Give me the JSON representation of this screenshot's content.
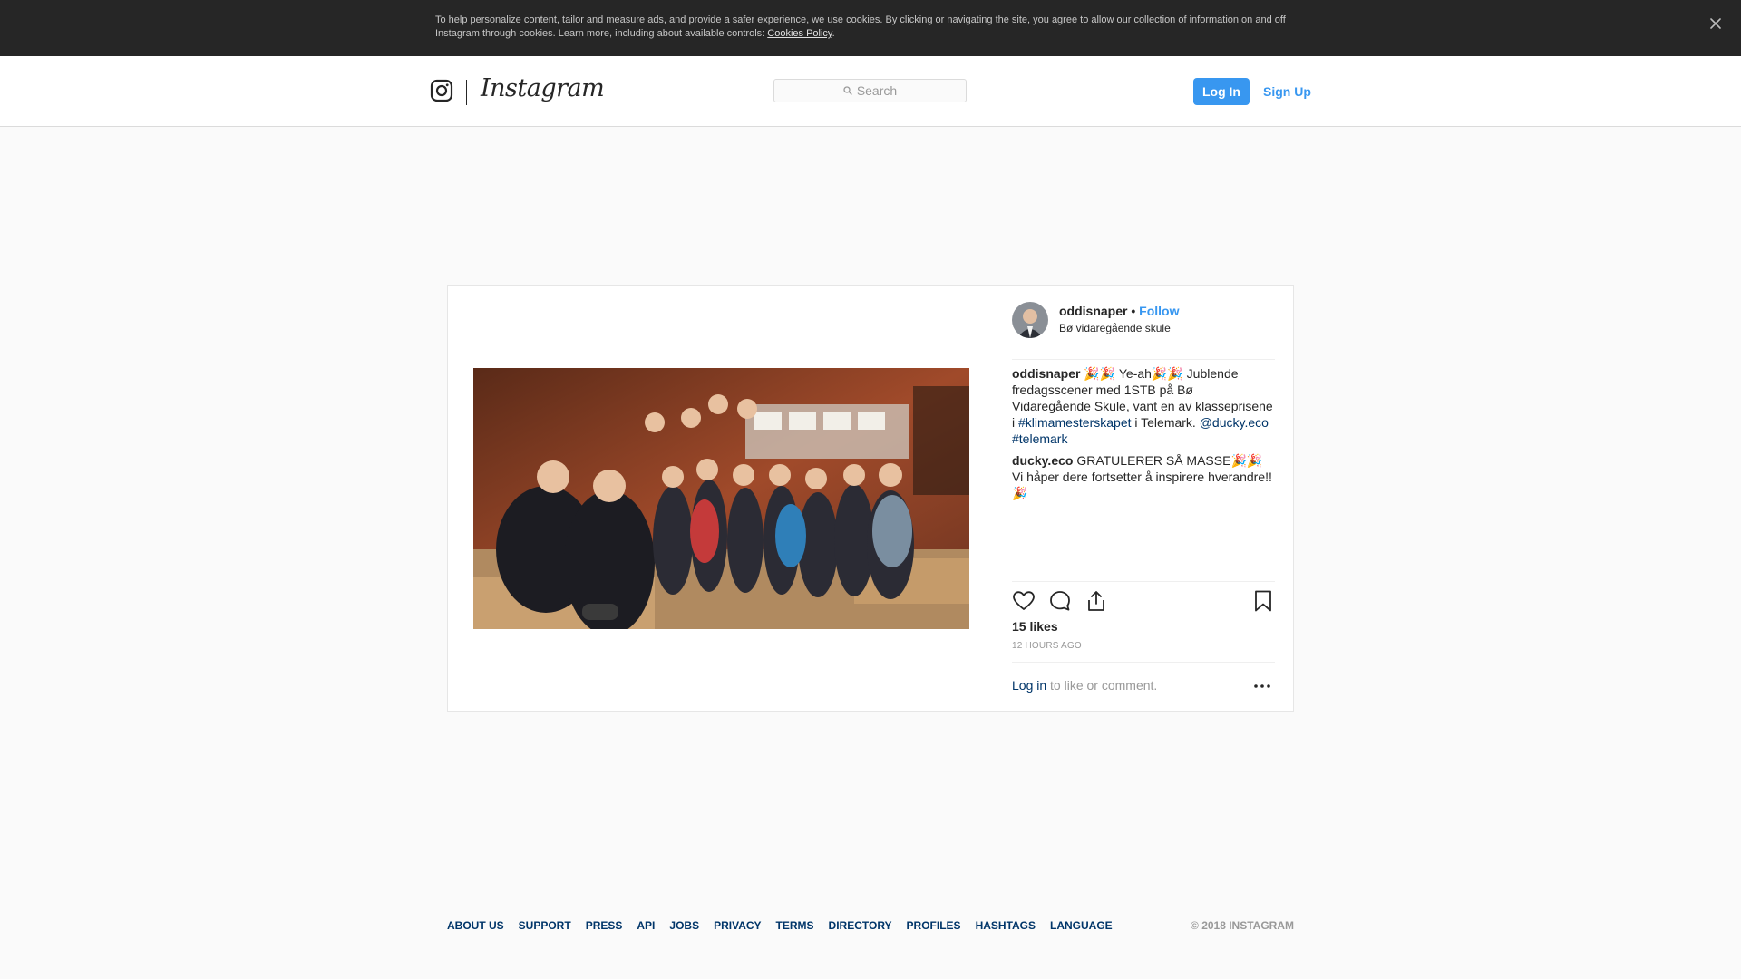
{
  "cookie_banner": {
    "text": "To help personalize content, tailor and measure ads, and provide a safer experience, we use cookies. By clicking or navigating the site, you agree to allow our collection of information on and off Instagram through cookies. Learn more, including about available controls: ",
    "link_label": "Cookies Policy",
    "period": ".",
    "close_icon": "close-icon"
  },
  "nav": {
    "logo_icon": "instagram-camera-icon",
    "wordmark": "Instagram",
    "search_placeholder": "Search",
    "login_label": "Log In",
    "signup_label": "Sign Up"
  },
  "post": {
    "username": "oddisnaper",
    "dot": " • ",
    "follow_label": "Follow",
    "location": "Bø vidaregående skule",
    "comments": [
      {
        "user": "oddisnaper",
        "text_1": " 🎉🎉 Ye-ah🎉🎉 Jublende fredagsscener med 1STB på Bø Vidaregående Skule, vant en av klasseprisene i ",
        "hashtag_1": "#klimamesterskapet",
        "text_2": " i Telemark. ",
        "mention": "@ducky.eco",
        "space": " ",
        "hashtag_2": "#telemark"
      },
      {
        "user": "ducky.eco",
        "text": " GRATULERER SÅ MASSE🎉🎉 Vi håper dere fortsetter å inspirere hverandre!!🎉"
      }
    ],
    "likes": "15 likes",
    "time": "12 HOURS AGO",
    "login_link": "Log in",
    "login_suffix": " to like or comment.",
    "icons": [
      "heart-icon",
      "comment-icon",
      "share-icon",
      "bookmark-icon",
      "more-options-icon"
    ]
  },
  "footer": {
    "links": [
      "ABOUT US",
      "SUPPORT",
      "PRESS",
      "API",
      "JOBS",
      "PRIVACY",
      "TERMS",
      "DIRECTORY",
      "PROFILES",
      "HASHTAGS",
      "LANGUAGE"
    ],
    "copyright": "© 2018 INSTAGRAM"
  },
  "colors": {
    "accent_blue": "#3897f0",
    "link_dark_blue": "#003569",
    "banner_bg": "#262626",
    "page_bg": "#fafafa"
  }
}
